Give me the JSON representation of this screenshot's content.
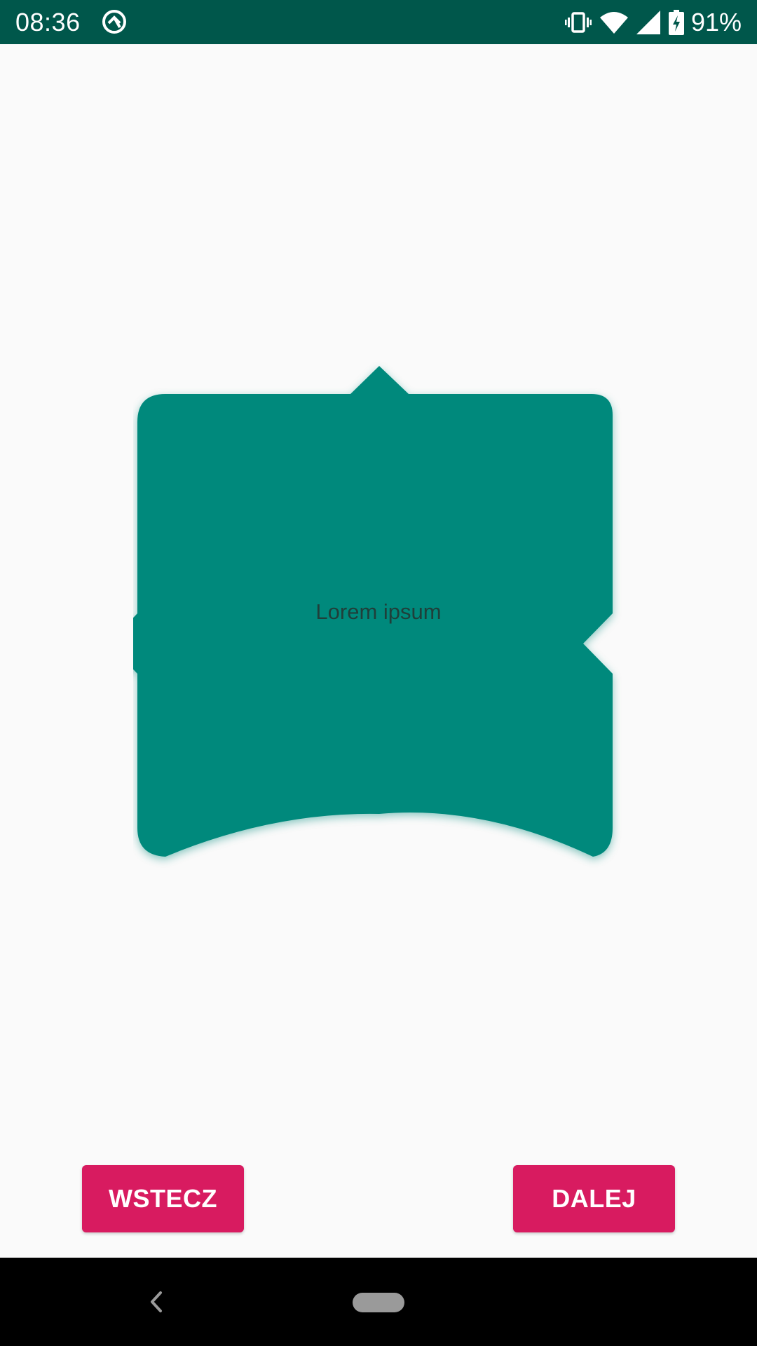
{
  "status_bar": {
    "time": "08:36",
    "battery_percent": "91%",
    "icons": [
      "app-notification-icon",
      "vibrate-icon",
      "wifi-icon",
      "cell-signal-icon",
      "battery-charging-icon"
    ],
    "background_color": "#00574b"
  },
  "shape": {
    "label": "Lorem ipsum",
    "fill_color": "#00897b"
  },
  "buttons": {
    "back_label": "WSTECZ",
    "next_label": "DALEJ",
    "color": "#d81b60"
  },
  "navigation_bar": {
    "icons": [
      "back-icon",
      "home-pill-icon"
    ]
  }
}
